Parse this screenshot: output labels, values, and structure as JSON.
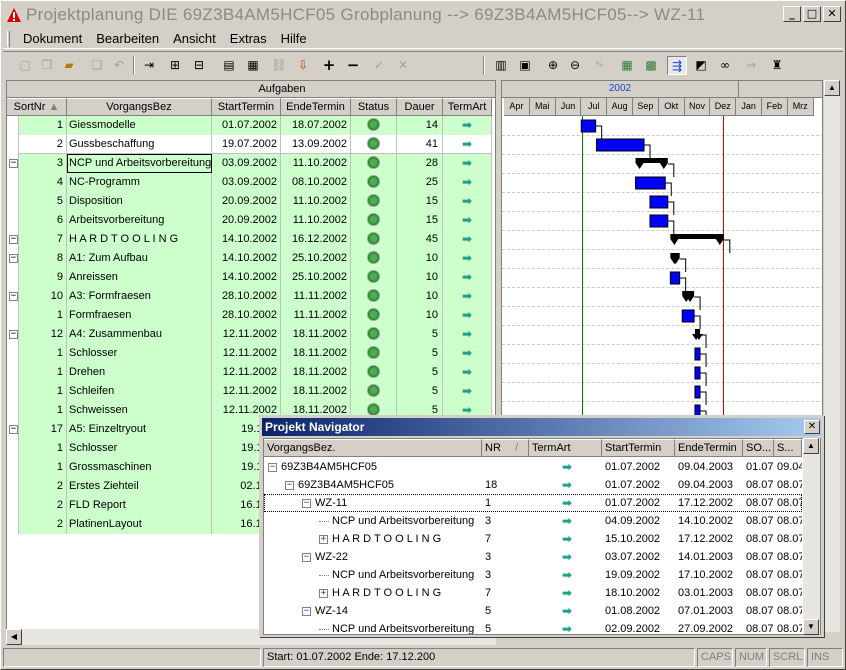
{
  "window": {
    "title": "Projektplanung   DIE  69Z3B4AM5HCF05  Grobplanung --> 69Z3B4AM5HCF05--> WZ-11",
    "min": "_",
    "max": "□",
    "close": "✕"
  },
  "menu": [
    "Dokument",
    "Bearbeiten",
    "Ansicht",
    "Extras",
    "Hilfe"
  ],
  "grid": {
    "group_header": "Aufgaben",
    "columns": [
      "SortNr",
      "VorgangsBez",
      "StartTermin",
      "EndeTermin",
      "Status",
      "Dauer",
      "TermArt"
    ],
    "rows": [
      {
        "sort": "1",
        "name": "Giessmodelle",
        "start": "01.07.2002",
        "end": "18.07.2002",
        "dauer": "14",
        "green": true
      },
      {
        "sort": "2",
        "name": "Gussbeschaffung",
        "start": "19.07.2002",
        "end": "13.09.2002",
        "dauer": "41",
        "green": false
      },
      {
        "sort": "3",
        "name": "NCP und Arbeitsvorbereitung",
        "start": "03.09.2002",
        "end": "11.10.2002",
        "dauer": "28",
        "green": true
      },
      {
        "sort": "4",
        "name": "NC-Programm",
        "start": "03.09.2002",
        "end": "08.10.2002",
        "dauer": "25",
        "green": true
      },
      {
        "sort": "5",
        "name": "Disposition",
        "start": "20.09.2002",
        "end": "11.10.2002",
        "dauer": "15",
        "green": true
      },
      {
        "sort": "6",
        "name": "Arbeitsvorbereitung",
        "start": "20.09.2002",
        "end": "11.10.2002",
        "dauer": "15",
        "green": true
      },
      {
        "sort": "7",
        "name": "H A R D T O O L I N G",
        "start": "14.10.2002",
        "end": "16.12.2002",
        "dauer": "45",
        "green": true
      },
      {
        "sort": "8",
        "name": "A1: Zum Aufbau",
        "start": "14.10.2002",
        "end": "25.10.2002",
        "dauer": "10",
        "green": true
      },
      {
        "sort": "9",
        "name": "Anreissen",
        "start": "14.10.2002",
        "end": "25.10.2002",
        "dauer": "10",
        "green": true
      },
      {
        "sort": "10",
        "name": "A3: Formfraesen",
        "start": "28.10.2002",
        "end": "11.11.2002",
        "dauer": "10",
        "green": true
      },
      {
        "sort": "1",
        "name": "Formfraesen",
        "start": "28.10.2002",
        "end": "11.11.2002",
        "dauer": "10",
        "green": true
      },
      {
        "sort": "12",
        "name": "A4: Zusammenbau",
        "start": "12.11.2002",
        "end": "18.11.2002",
        "dauer": "5",
        "green": true
      },
      {
        "sort": "1",
        "name": "Schlosser",
        "start": "12.11.2002",
        "end": "18.11.2002",
        "dauer": "5",
        "green": true
      },
      {
        "sort": "1",
        "name": "Drehen",
        "start": "12.11.2002",
        "end": "18.11.2002",
        "dauer": "5",
        "green": true
      },
      {
        "sort": "1",
        "name": "Schleifen",
        "start": "12.11.2002",
        "end": "18.11.2002",
        "dauer": "5",
        "green": true
      },
      {
        "sort": "1",
        "name": "Schweissen",
        "start": "12.11.2002",
        "end": "18.11.2002",
        "dauer": "5",
        "green": true
      },
      {
        "sort": "17",
        "name": "A5: Einzeltryout",
        "start": "19.11.2",
        "end": "",
        "dauer": "",
        "green": true
      },
      {
        "sort": "1",
        "name": "Schlosser",
        "start": "19.11.2",
        "end": "",
        "dauer": "",
        "green": true
      },
      {
        "sort": "1",
        "name": "Grossmaschinen",
        "start": "19.11.2",
        "end": "",
        "dauer": "",
        "green": true
      },
      {
        "sort": "2",
        "name": "Erstes Ziehteil",
        "start": "02.12.2",
        "end": "",
        "dauer": "",
        "green": true
      },
      {
        "sort": "2",
        "name": "FLD Report",
        "start": "16.12.2",
        "end": "",
        "dauer": "",
        "green": true
      },
      {
        "sort": "2",
        "name": "PlatinenLayout",
        "start": "16.12.2",
        "end": "",
        "dauer": "",
        "green": true
      }
    ]
  },
  "gantt": {
    "year": "2002",
    "months": [
      "Apr",
      "Mai",
      "Jun",
      "Jul",
      "Aug",
      "Sep",
      "Okt",
      "Nov",
      "Dez",
      "Jan",
      "Feb",
      "Mrz"
    ],
    "today_color": "#008000",
    "deadline_color": "#cc0000"
  },
  "navigator": {
    "title": "Projekt Navigator",
    "close": "✕",
    "columns": [
      "VorgangsBez.",
      "NR",
      "/",
      "TermArt",
      "StartTermin",
      "EndeTermin",
      "SO...",
      "S..."
    ],
    "rows": [
      {
        "indent": 0,
        "pm": "−",
        "name": "69Z3B4AM5HCF05",
        "nr": "",
        "start": "01.07.2002",
        "end": "09.04.2003",
        "so": "01.07",
        "s": "09.04"
      },
      {
        "indent": 1,
        "pm": "−",
        "name": "69Z3B4AM5HCF05",
        "nr": "18",
        "start": "01.07.2002",
        "end": "09.04.2003",
        "so": "08.07",
        "s": "08.07"
      },
      {
        "indent": 2,
        "pm": "−",
        "name": "WZ-11",
        "nr": "1",
        "start": "01.07.2002",
        "end": "17.12.2002",
        "so": "08.07",
        "s": "08.07"
      },
      {
        "indent": 3,
        "pm": "",
        "name": "NCP und Arbeitsvorbereitung",
        "nr": "3",
        "start": "04.09.2002",
        "end": "14.10.2002",
        "so": "08.07",
        "s": "08.07"
      },
      {
        "indent": 3,
        "pm": "+",
        "name": "H A R D T O O L I N G",
        "nr": "7",
        "start": "15.10.2002",
        "end": "17.12.2002",
        "so": "08.07",
        "s": "08.07"
      },
      {
        "indent": 2,
        "pm": "−",
        "name": "WZ-22",
        "nr": "3",
        "start": "03.07.2002",
        "end": "14.01.2003",
        "so": "08.07",
        "s": "08.07"
      },
      {
        "indent": 3,
        "pm": "",
        "name": "NCP und Arbeitsvorbereitung",
        "nr": "3",
        "start": "19.09.2002",
        "end": "17.10.2002",
        "so": "08.07",
        "s": "08.07"
      },
      {
        "indent": 3,
        "pm": "+",
        "name": "H A R D T O O L I N G",
        "nr": "7",
        "start": "18.10.2002",
        "end": "03.01.2003",
        "so": "08.07",
        "s": "08.07"
      },
      {
        "indent": 2,
        "pm": "−",
        "name": "WZ-14",
        "nr": "5",
        "start": "01.08.2002",
        "end": "07.01.2003",
        "so": "08.07",
        "s": "08.07"
      },
      {
        "indent": 3,
        "pm": "",
        "name": "NCP und Arbeitsvorbereitung",
        "nr": "5",
        "start": "02.09.2002",
        "end": "27.09.2002",
        "so": "08.07",
        "s": "08.07"
      }
    ]
  },
  "statusbar": {
    "info": "Start: 01.07.2002 Ende: 17.12.200",
    "caps": "CAPS",
    "num": "NUM",
    "scrl": "SCRL",
    "ins": "INS"
  }
}
